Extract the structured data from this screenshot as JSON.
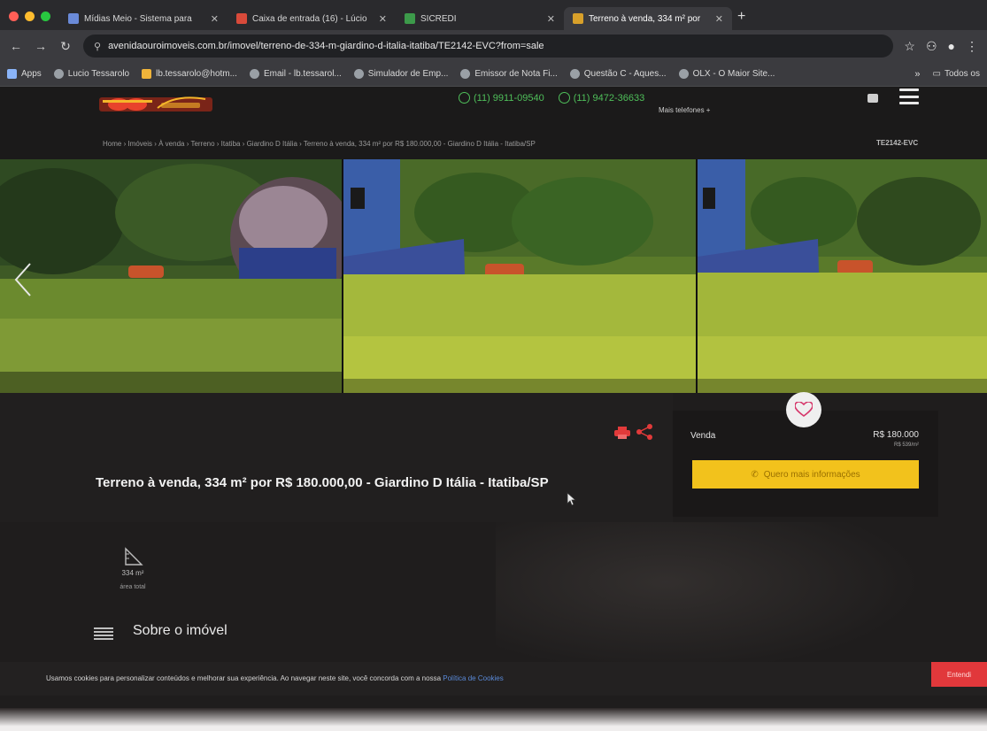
{
  "browser": {
    "tabs": [
      {
        "label": "Mídias Meio - Sistema para",
        "icon_color": "#6a8ad8",
        "active": false
      },
      {
        "label": "Caixa de entrada (16) - Lúcio",
        "icon_color": "#d84a3a",
        "active": false
      },
      {
        "label": "SICREDI",
        "icon_color": "#3c9a4a",
        "active": false
      },
      {
        "label": "Terreno à venda, 334 m² por",
        "icon_color": "#d8a02a",
        "active": true
      }
    ],
    "url": "avenidaouroimoveis.com.br/imovel/terreno-de-334-m-giardino-d-italia-itatiba/TE2142-EVC?from=sale",
    "bookmarks": [
      "Apps",
      "Lucio Tessarolo",
      "lb.tessarolo@hotm...",
      "Email - lb.tessarol...",
      "Simulador de Emp...",
      "Emissor de Nota Fi...",
      "Questão C - Aques...",
      "OLX - O Maior Site..."
    ],
    "bookmarks_more": "»",
    "bookmarks_other": "Todos os"
  },
  "site": {
    "phones": [
      "(11) 9911-09540",
      "(11) 9472-36633"
    ],
    "more_phones": "Mais telefones +",
    "breadcrumb": "Home  ›  Imóveis  ›  À venda  ›  Terreno  ›  Itatiba  ›  Giardino D Itália  ›  Terreno à venda, 334 m² por R$ 180.000,00 - Giardino D Itália - Itatiba/SP",
    "ref_code": "TE2142-EVC"
  },
  "listing": {
    "title": "Terreno à venda, 334 m² por R$ 180.000,00 - Giardino D Itália - Itatiba/SP",
    "price_label": "Venda",
    "price_value": "R$ 180.000",
    "price_sub": "R$ 539/m²",
    "cta_label": "Quero mais informações",
    "area_value": "334 m²",
    "area_label": "área total",
    "about_heading": "Sobre o imóvel"
  },
  "cookie": {
    "text": "Usamos cookies para personalizar conteúdos e melhorar sua experiência. Ao navegar neste site, você concorda com a nossa",
    "link": "Política de Cookies",
    "accept": "Entendi"
  },
  "colors": {
    "accent_yellow": "#f2c21c",
    "whatsapp_green": "#4fbf5a",
    "share_red": "#e23a3a",
    "cookie_button": "#e1383b"
  }
}
